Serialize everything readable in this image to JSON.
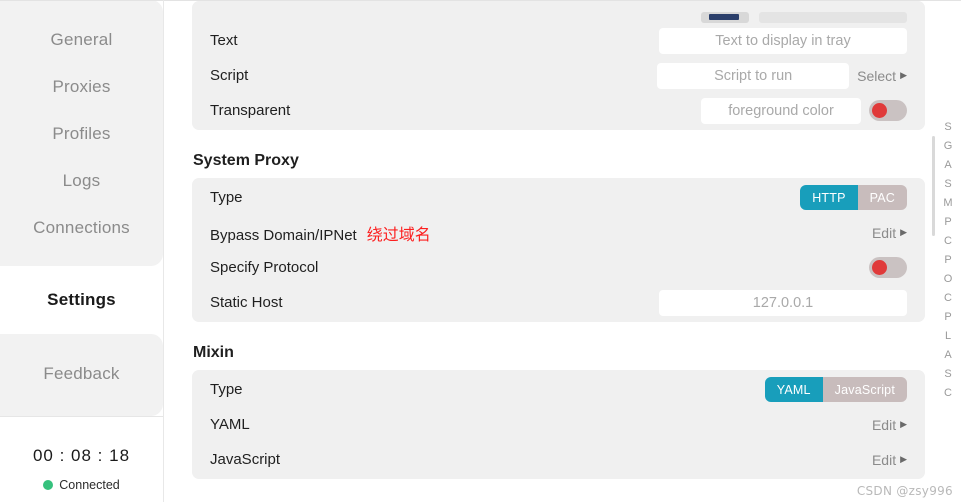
{
  "sidebar": {
    "nav_top": [
      {
        "label": "General"
      },
      {
        "label": "Proxies"
      },
      {
        "label": "Profiles"
      },
      {
        "label": "Logs"
      },
      {
        "label": "Connections"
      }
    ],
    "nav_selected": {
      "label": "Settings"
    },
    "nav_bottom": [
      {
        "label": "Feedback"
      }
    ],
    "status": {
      "timer": "00 : 08 : 18",
      "connection_label": "Connected",
      "connection_color": "#36c17d"
    }
  },
  "main": {
    "tray_section": {
      "rows": [
        {
          "label": "Text",
          "input_placeholder": "Text to display in tray",
          "input_value": ""
        },
        {
          "label": "Script",
          "input_placeholder": "Script to run",
          "input_value": "",
          "action_label": "Select",
          "action_caret": "▶"
        },
        {
          "label": "Transparent",
          "input_placeholder": "foreground color",
          "input_value": "",
          "switch_on": false
        }
      ]
    },
    "system_proxy": {
      "title": "System Proxy",
      "type_row": {
        "label": "Type",
        "options": [
          "HTTP",
          "PAC"
        ],
        "selected": "HTTP"
      },
      "bypass_row": {
        "label": "Bypass Domain/IPNet",
        "annotation": "绕过域名",
        "annotation_color": "#fc1f1f",
        "action_label": "Edit",
        "action_caret": "▶"
      },
      "specify_protocol_row": {
        "label": "Specify Protocol",
        "switch_on": false
      },
      "static_host_row": {
        "label": "Static Host",
        "input_placeholder": "127.0.0.1",
        "input_value": ""
      }
    },
    "mixin": {
      "title": "Mixin",
      "type_row": {
        "label": "Type",
        "options": [
          "YAML",
          "JavaScript"
        ],
        "selected": "YAML"
      },
      "yaml_row": {
        "label": "YAML",
        "action_label": "Edit",
        "action_caret": "▶"
      },
      "javascript_row": {
        "label": "JavaScript",
        "action_label": "Edit",
        "action_caret": "▶"
      }
    },
    "letter_rail": [
      "S",
      "G",
      "A",
      "S",
      "M",
      "P",
      "C",
      "P",
      "O",
      "C",
      "P",
      "L",
      "A",
      "S",
      "C"
    ]
  },
  "watermark": {
    "text": "CSDN @zsy996"
  },
  "theme": {
    "accent": "#189ebb",
    "inactive_segment": "#c8bcbc",
    "switch_knob": "#e03a3a",
    "card_bg": "#f0f0f0"
  }
}
